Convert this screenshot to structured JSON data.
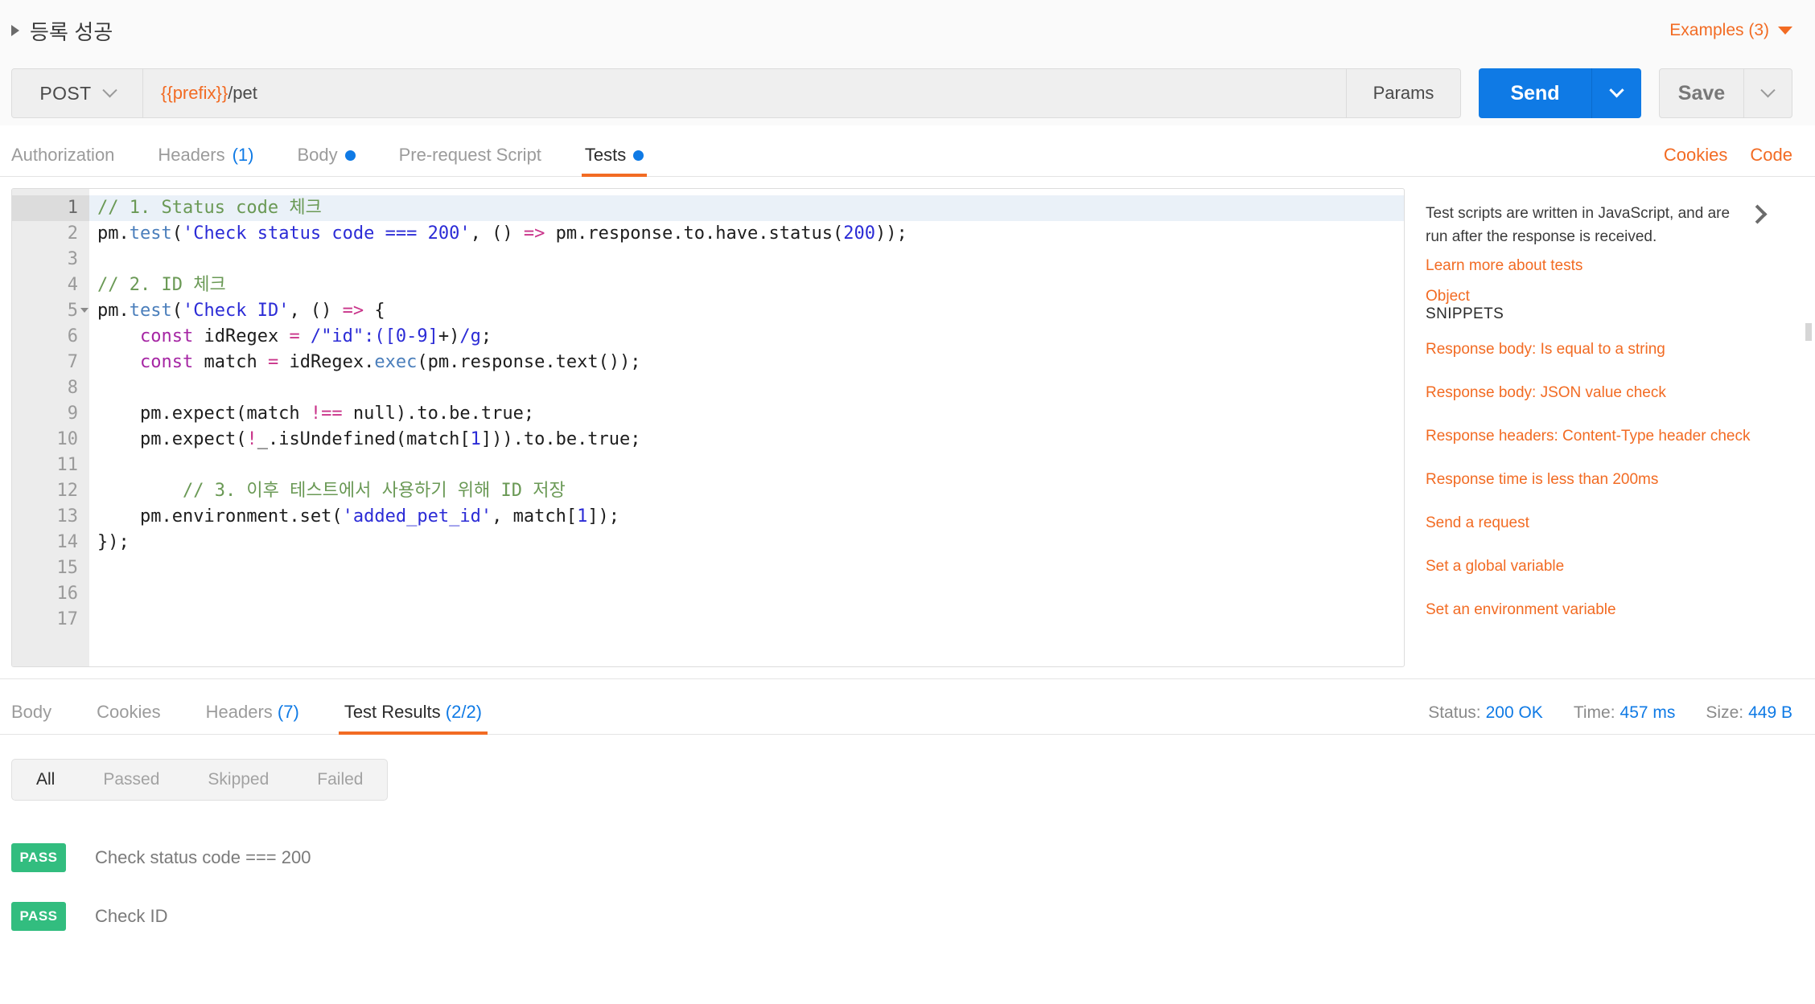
{
  "header": {
    "request_title": "등록 성공",
    "collapse_icon": "triangle-right-icon",
    "examples_label": "Examples (3)",
    "examples_caret_icon": "caret-down-icon"
  },
  "url_bar": {
    "method": "POST",
    "method_caret_icon": "chevron-down-icon",
    "url_variable": "{{prefix}}",
    "url_path": "/pet",
    "url_full": "{{prefix}}/pet",
    "params_label": "Params",
    "send_label": "Send",
    "send_caret_icon": "chevron-down-icon",
    "save_label": "Save",
    "save_caret_icon": "chevron-down-icon"
  },
  "request_tabs": {
    "items": [
      {
        "label": "Authorization",
        "count": "",
        "dot": false,
        "active": false
      },
      {
        "label": "Headers",
        "count": "(1)",
        "dot": false,
        "active": false
      },
      {
        "label": "Body",
        "count": "",
        "dot": true,
        "active": false
      },
      {
        "label": "Pre-request Script",
        "count": "",
        "dot": false,
        "active": false
      },
      {
        "label": "Tests",
        "count": "",
        "dot": true,
        "active": true
      }
    ],
    "cookies_label": "Cookies",
    "code_label": "Code"
  },
  "editor": {
    "line_numbers": [
      "1",
      "2",
      "3",
      "4",
      "5",
      "6",
      "7",
      "8",
      "9",
      "10",
      "11",
      "12",
      "13",
      "14",
      "15",
      "16",
      "17"
    ],
    "active_line": "1",
    "fold_line": "5",
    "lines": [
      "// 1. Status code 체크",
      "pm.test('Check status code === 200', () => pm.response.to.have.status(200));",
      "",
      "// 2. ID 체크",
      "pm.test('Check ID', () => {",
      "    const idRegex = /\"id\":([0-9]+)/g;",
      "    const match = idRegex.exec(pm.response.text());",
      "",
      "    pm.expect(match !== null).to.be.true;",
      "    pm.expect(!_.isUndefined(match[1])).to.be.true;",
      "",
      "    // 3. 이후 테스트에서 사용하기 위해 ID 저장",
      "    pm.environment.set('added_pet_id', match[1]);",
      "});",
      "",
      "",
      ""
    ]
  },
  "snippets_panel": {
    "intro_line1": "Test scripts are written in JavaScript, and are",
    "intro_line2": "run after the response is received.",
    "learn_more_label": "Learn more about tests",
    "collapse_icon": "chevron-right-icon",
    "section_title": "SNIPPETS",
    "partially_hidden_item": "Object",
    "items": [
      "Response body: Is equal to a string",
      "Response body: JSON value check",
      "Response headers: Content-Type header check",
      "Response time is less than 200ms",
      "Send a request",
      "Set a global variable",
      "Set an environment variable"
    ]
  },
  "response_tabs": {
    "items": [
      {
        "label": "Body",
        "count": "",
        "active": false
      },
      {
        "label": "Cookies",
        "count": "",
        "active": false
      },
      {
        "label": "Headers",
        "count": "(7)",
        "active": false
      },
      {
        "label": "Test Results",
        "count": "(2/2)",
        "active": true
      }
    ],
    "status_label": "Status:",
    "status_value": "200 OK",
    "time_label": "Time:",
    "time_value": "457 ms",
    "size_label": "Size:",
    "size_value": "449 B"
  },
  "test_results": {
    "filters": [
      {
        "label": "All",
        "active": true
      },
      {
        "label": "Passed",
        "active": false
      },
      {
        "label": "Skipped",
        "active": false
      },
      {
        "label": "Failed",
        "active": false
      }
    ],
    "rows": [
      {
        "status": "PASS",
        "name": "Check status code === 200"
      },
      {
        "status": "PASS",
        "name": "Check ID"
      }
    ]
  },
  "colors": {
    "accent_orange": "#f26b23",
    "accent_blue": "#0f7ae5",
    "pass_green": "#32bd7f",
    "text_dark": "#2b2b2b",
    "text_muted": "#9b9b9b"
  }
}
